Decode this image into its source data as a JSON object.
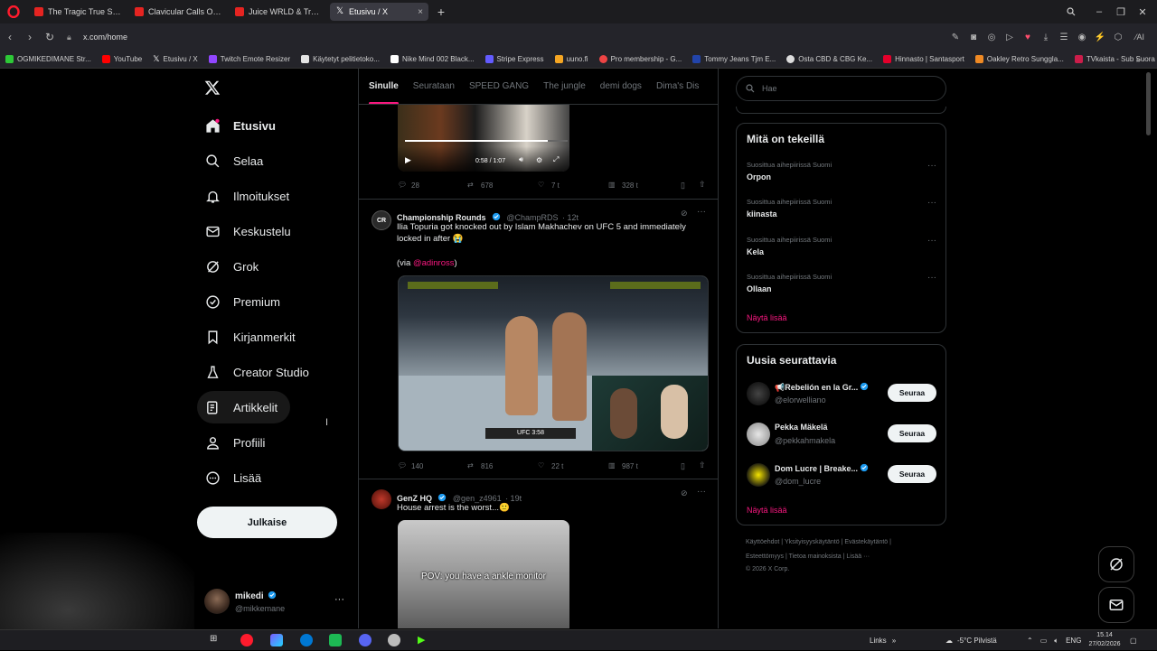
{
  "browser": {
    "tabs": [
      {
        "label": "The Tragic True Story of Ju",
        "active": false
      },
      {
        "label": "Clavicular Calls Out Larry",
        "active": false
      },
      {
        "label": "Juice WRLD & Travis Scott",
        "active": false
      },
      {
        "label": "Etusivu / X",
        "active": true
      }
    ],
    "url": "x.com/home",
    "bookmarks": [
      {
        "label": "OGMIKEDIMANE Str...",
        "color": "#2dc937"
      },
      {
        "label": "YouTube",
        "color": "#ff0000"
      },
      {
        "label": "Etusivu / X",
        "color": "#ffffff"
      },
      {
        "label": "Twitch Emote Resizer",
        "color": "#9146ff"
      },
      {
        "label": "Käytetyt pelitietoko...",
        "color": "#e4e4e4"
      },
      {
        "label": "Nike Mind 002 Black...",
        "color": "#ffffff"
      },
      {
        "label": "Stripe Express",
        "color": "#635bff"
      },
      {
        "label": "uuno.fi",
        "color": "#f5a623"
      },
      {
        "label": "Pro membership - G...",
        "color": "#e44"
      },
      {
        "label": "Tommy Jeans Tjm E...",
        "color": "#2244aa"
      },
      {
        "label": "Osta CBD & CBG Ke...",
        "color": "#ddd"
      },
      {
        "label": "Hinnasto | Santasport",
        "color": "#e4002b"
      },
      {
        "label": "Oakley Retro Sunggla...",
        "color": "#f08a24"
      },
      {
        "label": "TVkaista - Sub Suora",
        "color": "#cc1d4a"
      }
    ]
  },
  "sidebar": {
    "items": [
      {
        "label": "Etusivu",
        "icon": "home-icon"
      },
      {
        "label": "Selaa",
        "icon": "search-icon"
      },
      {
        "label": "Ilmoitukset",
        "icon": "bell-icon"
      },
      {
        "label": "Keskustelu",
        "icon": "mail-icon"
      },
      {
        "label": "Grok",
        "icon": "grok-icon"
      },
      {
        "label": "Premium",
        "icon": "premium-icon"
      },
      {
        "label": "Kirjanmerkit",
        "icon": "bookmark-icon"
      },
      {
        "label": "Creator Studio",
        "icon": "creator-icon"
      },
      {
        "label": "Artikkelit",
        "icon": "article-icon"
      },
      {
        "label": "Profiili",
        "icon": "person-icon"
      },
      {
        "label": "Lisää",
        "icon": "more-circle-icon"
      }
    ],
    "post_label": "Julkaise",
    "user": {
      "name": "mikedi",
      "handle": "@mikkemane"
    }
  },
  "feed": {
    "tabs": [
      "Sinulle",
      "Seurataan",
      "SPEED GANG",
      "The jungle",
      "demi dogs",
      "Dima's Dis"
    ],
    "post0": {
      "video_time": "0:58 / 1:07",
      "replies": "28",
      "reposts": "678",
      "likes": "7 t",
      "views": "328 t"
    },
    "post1": {
      "name": "Championship Rounds",
      "handle": "@ChampRDS",
      "time": "· 12t",
      "text1": "Ilia Topuria got knocked out by Islam Makhachev on UFC 5 and immediately locked in after 😭",
      "text2_prefix": "(via ",
      "text2_mention": "@adinross",
      "text2_suffix": ")",
      "replies": "140",
      "reposts": "816",
      "likes": "22 t",
      "views": "987 t"
    },
    "post2": {
      "name": "GenZ HQ",
      "handle": "@gen_z4961",
      "time": "· 19t",
      "text": "House arrest is the worst...🙂",
      "caption": "POV: you have a ankle monitor"
    }
  },
  "right": {
    "search_placeholder": "Hae",
    "trends_title": "Mitä on tekeillä",
    "trends": [
      {
        "context": "Suosittua aihepiirissä Suomi",
        "name": "Orpon"
      },
      {
        "context": "Suosittua aihepiirissä Suomi",
        "name": "kiinasta"
      },
      {
        "context": "Suosittua aihepiirissä Suomi",
        "name": "Kela"
      },
      {
        "context": "Suosittua aihepiirissä Suomi",
        "name": "Ollaan"
      }
    ],
    "show_more": "Näytä lisää",
    "follow_title": "Uusia seurattavia",
    "follow": [
      {
        "name": "📢Rebelión en la Gr...",
        "handle": "@elorwelliano"
      },
      {
        "name": "Pekka Mäkelä",
        "handle": "@pekkahmakela"
      },
      {
        "name": "Dom Lucre | Breake...",
        "handle": "@dom_lucre"
      }
    ],
    "follow_btn": "Seuraa",
    "footer1": "Käyttöehdot  |  Yksityisyyskäytäntö  |  Evästekäytäntö  |",
    "footer2": "Esteettömyys  |  Tietoa mainoksista  |  Lisää ···",
    "footer3": "© 2026 X Corp."
  },
  "taskbar": {
    "links": "Links",
    "weather": "-5°C  Pilvistä",
    "lang": "ENG",
    "time": "15.14",
    "date": "27/02/2026"
  },
  "colors": {
    "accent": "#f91880",
    "verified": "#1d9bf0",
    "bg": "#000000"
  }
}
